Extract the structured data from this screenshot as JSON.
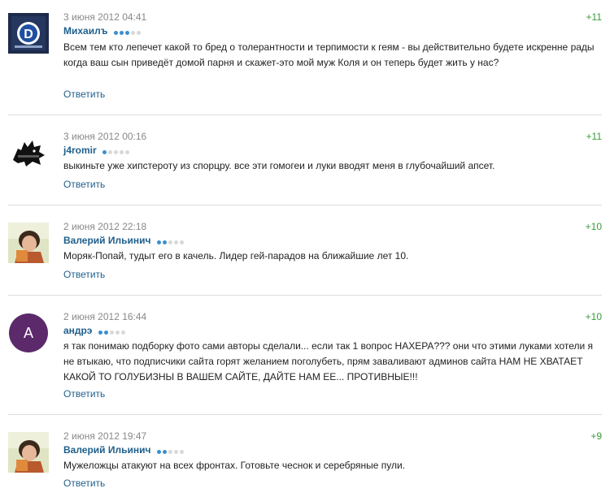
{
  "colors": {
    "author": "#1f5f8b",
    "score": "#3a9b3a",
    "rating_on": "#3a8fd0",
    "rating_off": "#d8d8d8",
    "divider": "#dcdcdc"
  },
  "reply_label": "Ответить",
  "comments": [
    {
      "date": "3 июня 2012 04:41",
      "author": "Михаилъ",
      "rating_dots": 3,
      "score": "+11",
      "avatar_icon": "dynamo-logo-icon",
      "text": "Всем тем кто лепечет какой то бред о толерантности и терпимости к геям - вы действительно будете искренне рады когда ваш сын приведёт домой парня и скажет-это мой муж Коля и он теперь будет жить у нас?"
    },
    {
      "date": "3 июня 2012 00:16",
      "author": "j4romir",
      "rating_dots": 1,
      "score": "+11",
      "avatar_icon": "direwolf-icon",
      "text": "выкиньте уже хипстероту из спорцру. все эти гомогеи и луки вводят меня в глубочайший апсет."
    },
    {
      "date": "2 июня 2012 22:18",
      "author": "Валерий Ильинич",
      "rating_dots": 2,
      "score": "+10",
      "avatar_icon": "user-photo-icon",
      "text": "Моряк-Попай, тудыт его в качель. Лидер гей-парадов на ближайшие лет 10."
    },
    {
      "date": "2 июня 2012 16:44",
      "author": "андрэ",
      "rating_dots": 2,
      "score": "+10",
      "avatar_icon": "letter-avatar-icon",
      "avatar_letter": "A",
      "avatar_color": "#5c2a6b",
      "text": "я так понимаю подборку фото сами авторы сделали... если так 1 вопрос НАХЕРА??? они что этими луками хотели я не втыкаю, что подписчики сайта горят желанием поголубеть, прям заваливают админов сайта НАМ НЕ ХВАТАЕТ КАКОЙ ТО ГОЛУБИЗНЫ В ВАШЕМ САЙТЕ, ДАЙТЕ НАМ ЕЕ... ПРОТИВНЫЕ!!!"
    },
    {
      "date": "2 июня 2012 19:47",
      "author": "Валерий Ильинич",
      "rating_dots": 2,
      "score": "+9",
      "avatar_icon": "user-photo-icon",
      "text": "Мужеложцы атакуют на всех фронтах. Готовьте чеснок и серебряные пули."
    }
  ]
}
